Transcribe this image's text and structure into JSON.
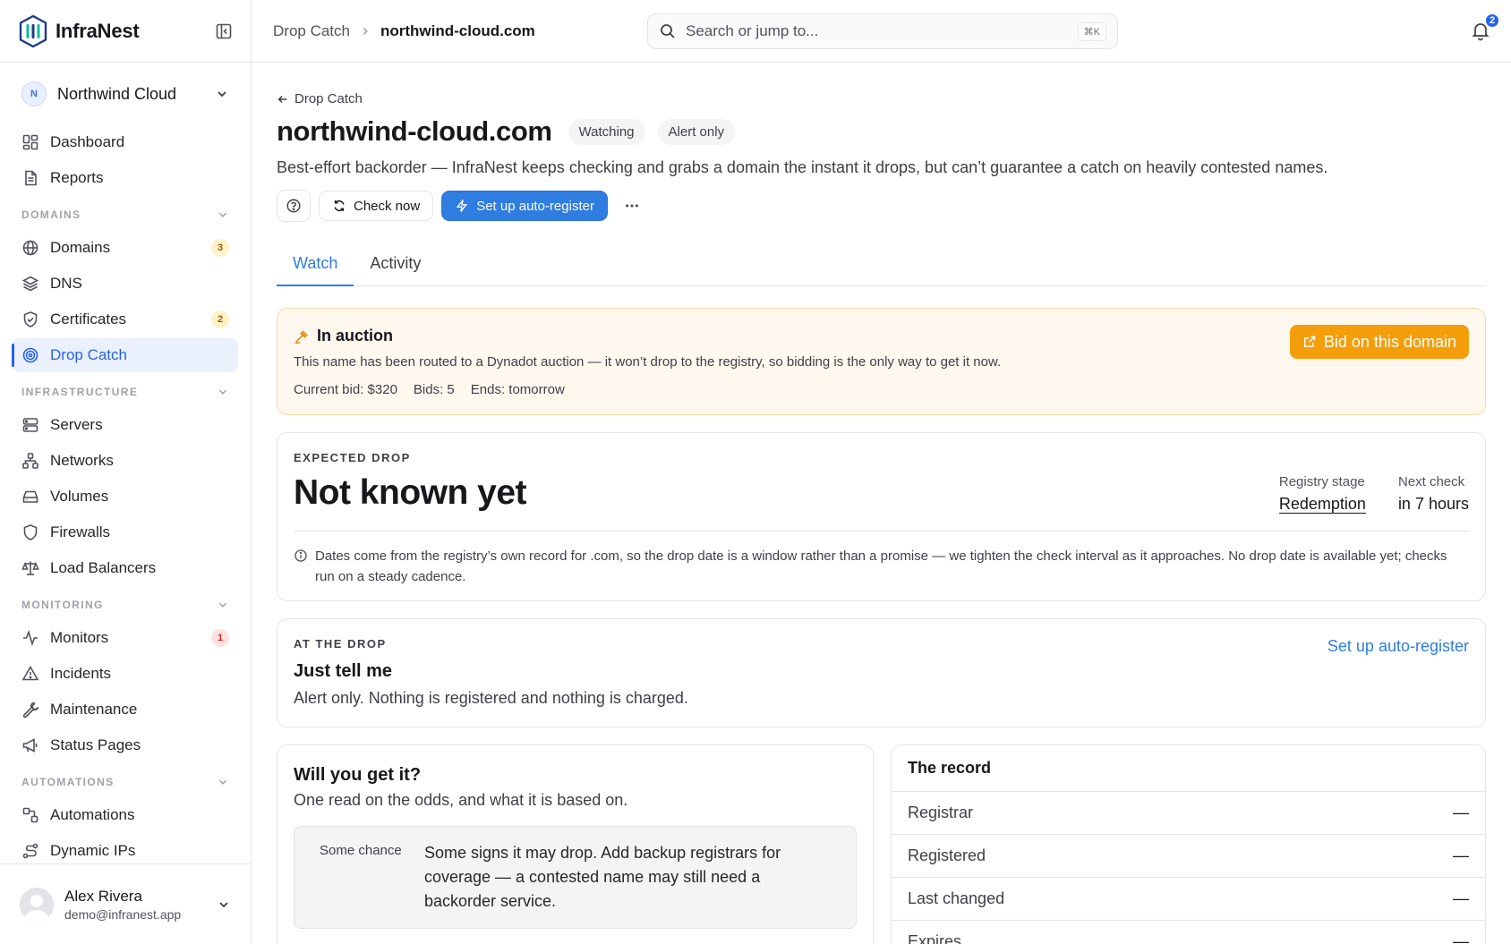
{
  "brand": {
    "name": "InfraNest"
  },
  "org": {
    "initial": "N",
    "name": "Northwind Cloud"
  },
  "nav": {
    "top": [
      {
        "label": "Dashboard",
        "icon": "dashboard-icon"
      },
      {
        "label": "Reports",
        "icon": "reports-icon"
      }
    ],
    "sections": [
      {
        "title": "DOMAINS",
        "items": [
          {
            "label": "Domains",
            "icon": "globe-icon",
            "badge": "3"
          },
          {
            "label": "DNS",
            "icon": "layers-icon"
          },
          {
            "label": "Certificates",
            "icon": "shield-check-icon",
            "badge": "2"
          },
          {
            "label": "Drop Catch",
            "icon": "target-icon",
            "active": true
          }
        ]
      },
      {
        "title": "INFRASTRUCTURE",
        "items": [
          {
            "label": "Servers",
            "icon": "server-icon"
          },
          {
            "label": "Networks",
            "icon": "network-icon"
          },
          {
            "label": "Volumes",
            "icon": "drive-icon"
          },
          {
            "label": "Firewalls",
            "icon": "shield-icon"
          },
          {
            "label": "Load Balancers",
            "icon": "scale-icon"
          }
        ]
      },
      {
        "title": "MONITORING",
        "items": [
          {
            "label": "Monitors",
            "icon": "activity-icon",
            "badge": "1"
          },
          {
            "label": "Incidents",
            "icon": "alert-triangle-icon"
          },
          {
            "label": "Maintenance",
            "icon": "wrench-icon"
          },
          {
            "label": "Status Pages",
            "icon": "megaphone-icon"
          }
        ]
      },
      {
        "title": "AUTOMATIONS",
        "items": [
          {
            "label": "Automations",
            "icon": "workflow-icon"
          },
          {
            "label": "Dynamic IPs",
            "icon": "route-icon"
          }
        ]
      }
    ]
  },
  "user": {
    "name": "Alex Rivera",
    "email": "demo@infranest.app"
  },
  "topbar": {
    "breadcrumb_parent": "Drop Catch",
    "breadcrumb_current": "northwind-cloud.com",
    "search_placeholder": "Search or jump to...",
    "search_shortcut": "⌘K",
    "notification_count": "2"
  },
  "page": {
    "back_label": "Drop Catch",
    "title": "northwind-cloud.com",
    "pill_watching": "Watching",
    "pill_alert": "Alert only",
    "description": "Best-effort backorder — InfraNest keeps checking and grabs a domain the instant it drops, but can’t guarantee a catch on heavily contested names.",
    "check_now": "Check now",
    "setup_auto": "Set up auto-register",
    "tabs": [
      "Watch",
      "Activity"
    ]
  },
  "auction": {
    "title": "In auction",
    "text": "This name has been routed to a Dynadot auction — it won’t drop to the registry, so bidding is the only way to get it now.",
    "current_bid": "Current bid: $320",
    "bids": "Bids: 5",
    "ends": "Ends: tomorrow",
    "button": "Bid on this domain"
  },
  "expected_drop": {
    "overline": "EXPECTED DROP",
    "value": "Not known yet",
    "stage_label": "Registry stage",
    "stage_value": "Redemption",
    "next_label": "Next check",
    "next_value": "in 7 hours",
    "note": "Dates come from the registry’s own record for .com, so the drop date is a window rather than a promise — we tighten the check interval as it approaches. No drop date is available yet; checks run on a steady cadence."
  },
  "at_drop": {
    "overline": "AT THE DROP",
    "title": "Just tell me",
    "text": "Alert only. Nothing is registered and nothing is charged.",
    "link": "Set up auto-register"
  },
  "odds": {
    "title": "Will you get it?",
    "subtitle": "One read on the odds, and what it is based on.",
    "chance_label": "Some chance",
    "chance_text": "Some signs it may drop. Add backup registrars for coverage — a contested name may still need a backorder service."
  },
  "record": {
    "title": "The record",
    "rows": [
      {
        "label": "Registrar",
        "value": "—"
      },
      {
        "label": "Registered",
        "value": "—"
      },
      {
        "label": "Last changed",
        "value": "—"
      },
      {
        "label": "Expires",
        "value": "—"
      }
    ]
  },
  "colors": {
    "accent": "#2f7de1",
    "auction_bg": "#fff8ef",
    "auction_border": "#fbd7a6",
    "bid_button": "#f59e0b"
  }
}
